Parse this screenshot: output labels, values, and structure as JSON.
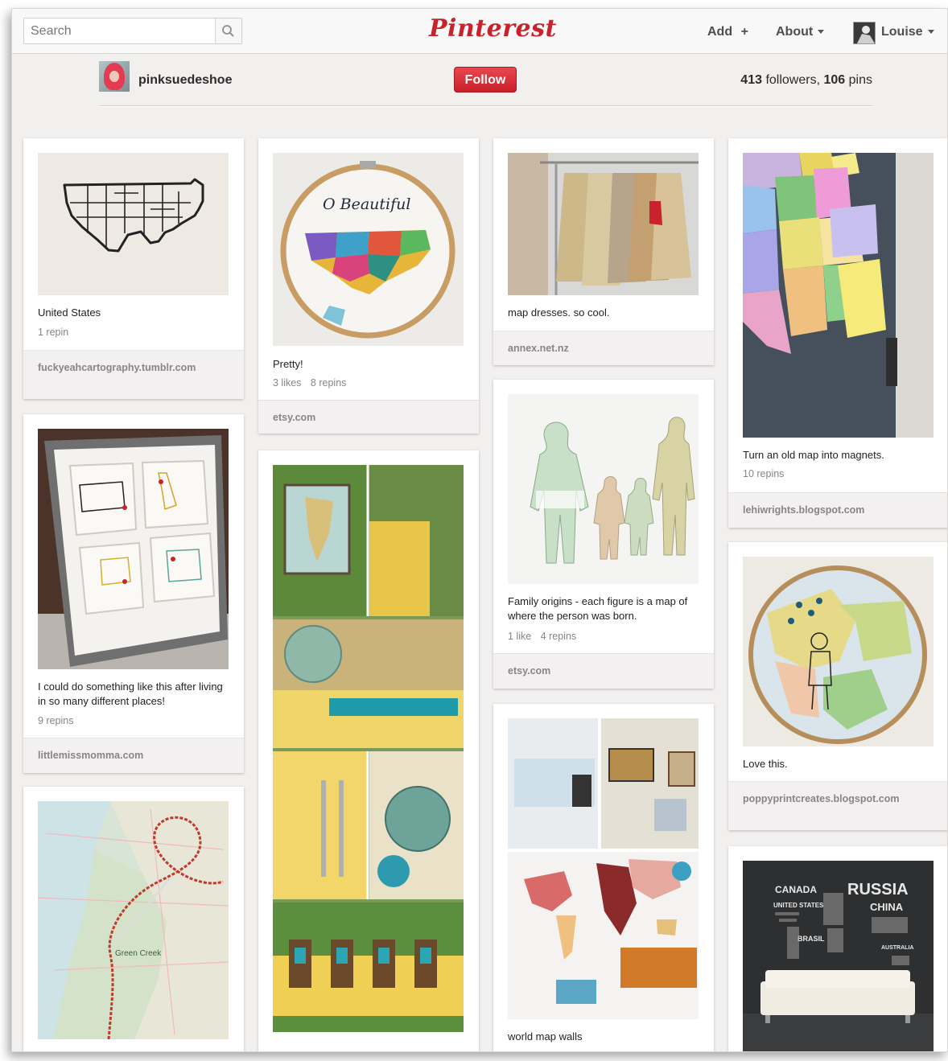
{
  "header": {
    "search_placeholder": "Search",
    "logo": "Pinterest",
    "nav": {
      "add": "Add",
      "add_symbol": "+",
      "about": "About",
      "user": "Louise"
    }
  },
  "profile": {
    "username": "pinksuedeshoe",
    "follow_label": "Follow",
    "followers_count": "413",
    "followers_label": "followers,",
    "pins_count": "106",
    "pins_label": "pins"
  },
  "pins": [
    {
      "description": "United States",
      "stats": [
        "1 repin"
      ],
      "source": "fuckyeahcartography.tumblr.com"
    },
    {
      "description": "I could do something like this after living in so many different places!",
      "stats": [
        "9 repins"
      ],
      "source": "littlemissmomma.com"
    },
    {
      "description": "",
      "stats": [],
      "source": ""
    },
    {
      "description": "Pretty!",
      "stats": [
        "3 likes",
        "8 repins"
      ],
      "source": "etsy.com"
    },
    {
      "description": "",
      "stats": [],
      "source": ""
    },
    {
      "description": "map dresses. so cool.",
      "stats": [],
      "source": "annex.net.nz"
    },
    {
      "description": "Family origins - each figure is a map of where the person was born.",
      "stats": [
        "1 like",
        "4 repins"
      ],
      "source": "etsy.com"
    },
    {
      "description": "world map walls",
      "stats": [],
      "source": ""
    },
    {
      "description": "Turn an old map into magnets.",
      "stats": [
        "10 repins"
      ],
      "source": "lehiwrights.blogspot.com"
    },
    {
      "description": "Love this.",
      "stats": [],
      "source": "poppyprintcreates.blogspot.com"
    },
    {
      "description": "",
      "stats": [],
      "source": ""
    }
  ],
  "image_text": {
    "embroidery": "O Beautiful",
    "map_label": "Green Creek",
    "wall_words": [
      "RUSSIA",
      "CANADA",
      "CHINA",
      "UNITED STATES",
      "BRASIL",
      "AUSTRALIA"
    ]
  },
  "colors": {
    "brand": "#c8232c",
    "background": "#f1f0ee",
    "source_bg": "#f2f0f0",
    "meta_text": "#8a8583"
  }
}
